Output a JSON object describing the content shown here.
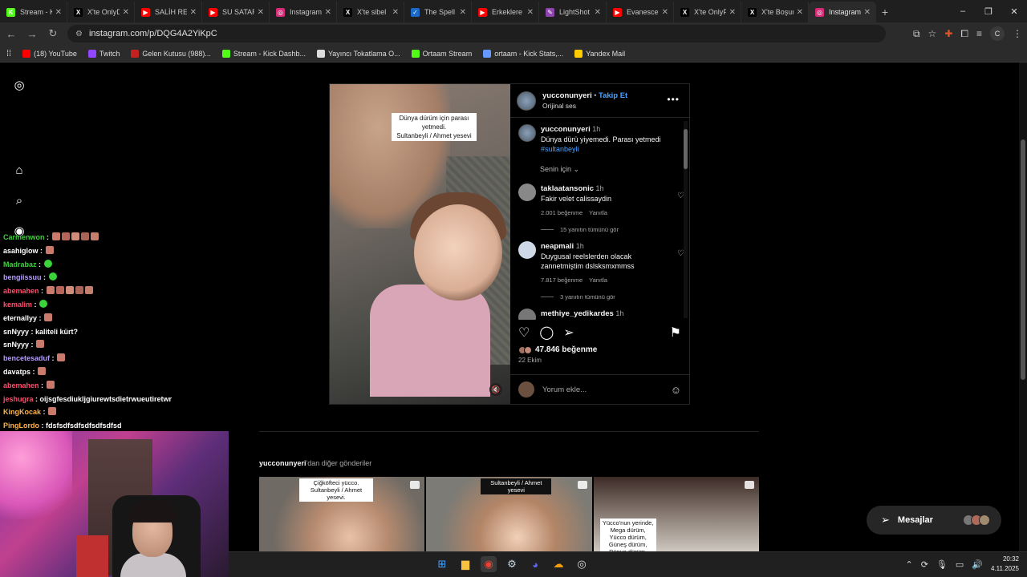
{
  "browser": {
    "tabs": [
      {
        "label": "Stream - K",
        "color": "#53fc18",
        "glyph": "K"
      },
      {
        "label": "X'te OnlyD",
        "color": "#000000",
        "glyph": "X"
      },
      {
        "label": "SALİH REİ",
        "color": "#ff0000",
        "glyph": "▶"
      },
      {
        "label": "SU SATAR",
        "color": "#ff0000",
        "glyph": "▶"
      },
      {
        "label": "Instagram",
        "color": "#d62976",
        "glyph": "◎"
      },
      {
        "label": "X'te sibel",
        "color": "#000000",
        "glyph": "X"
      },
      {
        "label": "The Spell",
        "color": "#1b6ac9",
        "glyph": "✓"
      },
      {
        "label": "Erkeklere",
        "color": "#ff0000",
        "glyph": "▶"
      },
      {
        "label": "LightShot",
        "color": "#8e44ad",
        "glyph": "✎"
      },
      {
        "label": "Evanescen",
        "color": "#ff0000",
        "glyph": "▶"
      },
      {
        "label": "X'te OnlyF",
        "color": "#000000",
        "glyph": "X"
      },
      {
        "label": "X'te Boşur",
        "color": "#000000",
        "glyph": "X"
      },
      {
        "label": "Instagram",
        "color": "#d62976",
        "glyph": "◎",
        "active": true
      }
    ],
    "new_tab": "+",
    "window_controls": [
      "–",
      "❐",
      "✕"
    ],
    "url": "instagram.com/p/DQG4A2YiKpC",
    "profile_initial": "C",
    "bookmarks": [
      {
        "label": "(18) YouTube",
        "color": "#ff0000"
      },
      {
        "label": "Twitch",
        "color": "#9146ff"
      },
      {
        "label": "Gelen Kutusu (988)...",
        "color": "#c5221f"
      },
      {
        "label": "Stream - Kick Dashb...",
        "color": "#53fc18"
      },
      {
        "label": "Yayıncı Tokatlama O...",
        "color": "#dddddd"
      },
      {
        "label": "Ortaam Stream",
        "color": "#53fc18"
      },
      {
        "label": "ortaam - Kick Stats,...",
        "color": "#6699ff"
      },
      {
        "label": "Yandex Mail",
        "color": "#ffcc00"
      }
    ]
  },
  "post": {
    "username": "yucconunyeri",
    "follow_label": "Takip Et",
    "audio": "Orijinal ses",
    "caption_overlay_1": "Dünya dürüm için parası yetmedi.",
    "caption_overlay_2": "Sultanbeyli / Ahmet yesevi",
    "caption": {
      "user": "yucconunyeri",
      "time": "1h",
      "text": "Dünya dürü  yiyemedi. Parası yetmedi",
      "hashtag": "#sultanbeyli"
    },
    "for_you": "Senin için",
    "comments": [
      {
        "user": "taklaatansonic",
        "time": "1h",
        "text": "Fakir velet calissaydin",
        "likes": "2.001 beğenme",
        "reply": "Yanıtla",
        "view_replies": "15 yanıtın tümünü gör",
        "avatar_color": "#888888"
      },
      {
        "user": "neapmali",
        "time": "1h",
        "text": "Duygusal reelslerden olacak zannetmiştim dslsksmxmmss",
        "likes": "7.817 beğenme",
        "reply": "Yanıtla",
        "view_replies": "3 yanıtın tümünü gör",
        "avatar_color": "#cfd8e6"
      },
      {
        "user": "methiye_yedikardes",
        "time": "1h",
        "avatar_color": "#777777"
      }
    ],
    "like_count": "47.846 beğenme",
    "date": "22 Ekim",
    "comment_placeholder": "Yorum ekle..."
  },
  "more_posts": {
    "title_user": "yucconunyeri",
    "title_rest": "'dan diğer gönderiler",
    "items": [
      {
        "caption": "Çiğköfteci yücco. Sultanbeyli / Ahmet yesevi."
      },
      {
        "caption": "Sultanbeyli / Ahmet yesevi"
      },
      {
        "caption": "Yücco'nun yerinde, Mega dürüm, Yücco dürüm, Güneş dürüm, Dünya dürüm,"
      }
    ]
  },
  "messages": {
    "label": "Mesajlar"
  },
  "chat": [
    {
      "user": "Carmenwon",
      "color": "#3ad33a",
      "msg": "",
      "emotes": 5
    },
    {
      "user": "asahiglow",
      "color": "#ffffff",
      "msg": "",
      "emotes": 1
    },
    {
      "user": "Madrabaz",
      "color": "#3ad33a",
      "msg": "",
      "emotes": 1
    },
    {
      "user": "bengiissuu",
      "color": "#b69cff",
      "msg": "",
      "emotes": 1
    },
    {
      "user": "abemahen",
      "color": "#ff4d6d",
      "msg": "",
      "emotes": 5
    },
    {
      "user": "kemalim",
      "color": "#ff4d6d",
      "msg": "",
      "emotes": 1
    },
    {
      "user": "eternallyy",
      "color": "#ffffff",
      "msg": "",
      "emotes": 1
    },
    {
      "user": "snNyyy",
      "color": "#ffffff",
      "msg": "kaliteli kürt?",
      "emotes": 0
    },
    {
      "user": "snNyyy",
      "color": "#ffffff",
      "msg": "",
      "emotes": 1
    },
    {
      "user": "bencetesaduf",
      "color": "#b69cff",
      "msg": "",
      "emotes": 1
    },
    {
      "user": "davatps",
      "color": "#ffffff",
      "msg": "",
      "emotes": 1
    },
    {
      "user": "abemahen",
      "color": "#ff4d6d",
      "msg": "",
      "emotes": 1
    },
    {
      "user": "jeshugra",
      "color": "#ff4d6d",
      "msg": "oijsgfesdiukljgiurewtsdietrwueutiretwr",
      "emotes": 0
    },
    {
      "user": "KingKocak",
      "color": "#ffb347",
      "msg": "",
      "emotes": 1
    },
    {
      "user": "PingLordo",
      "color": "#ffb347",
      "msg": "fdsfsdfsdfsdfsdfsdfsd",
      "emotes": 0
    }
  ],
  "taskbar": {
    "time": "20:32",
    "date": "4.11.2025"
  }
}
